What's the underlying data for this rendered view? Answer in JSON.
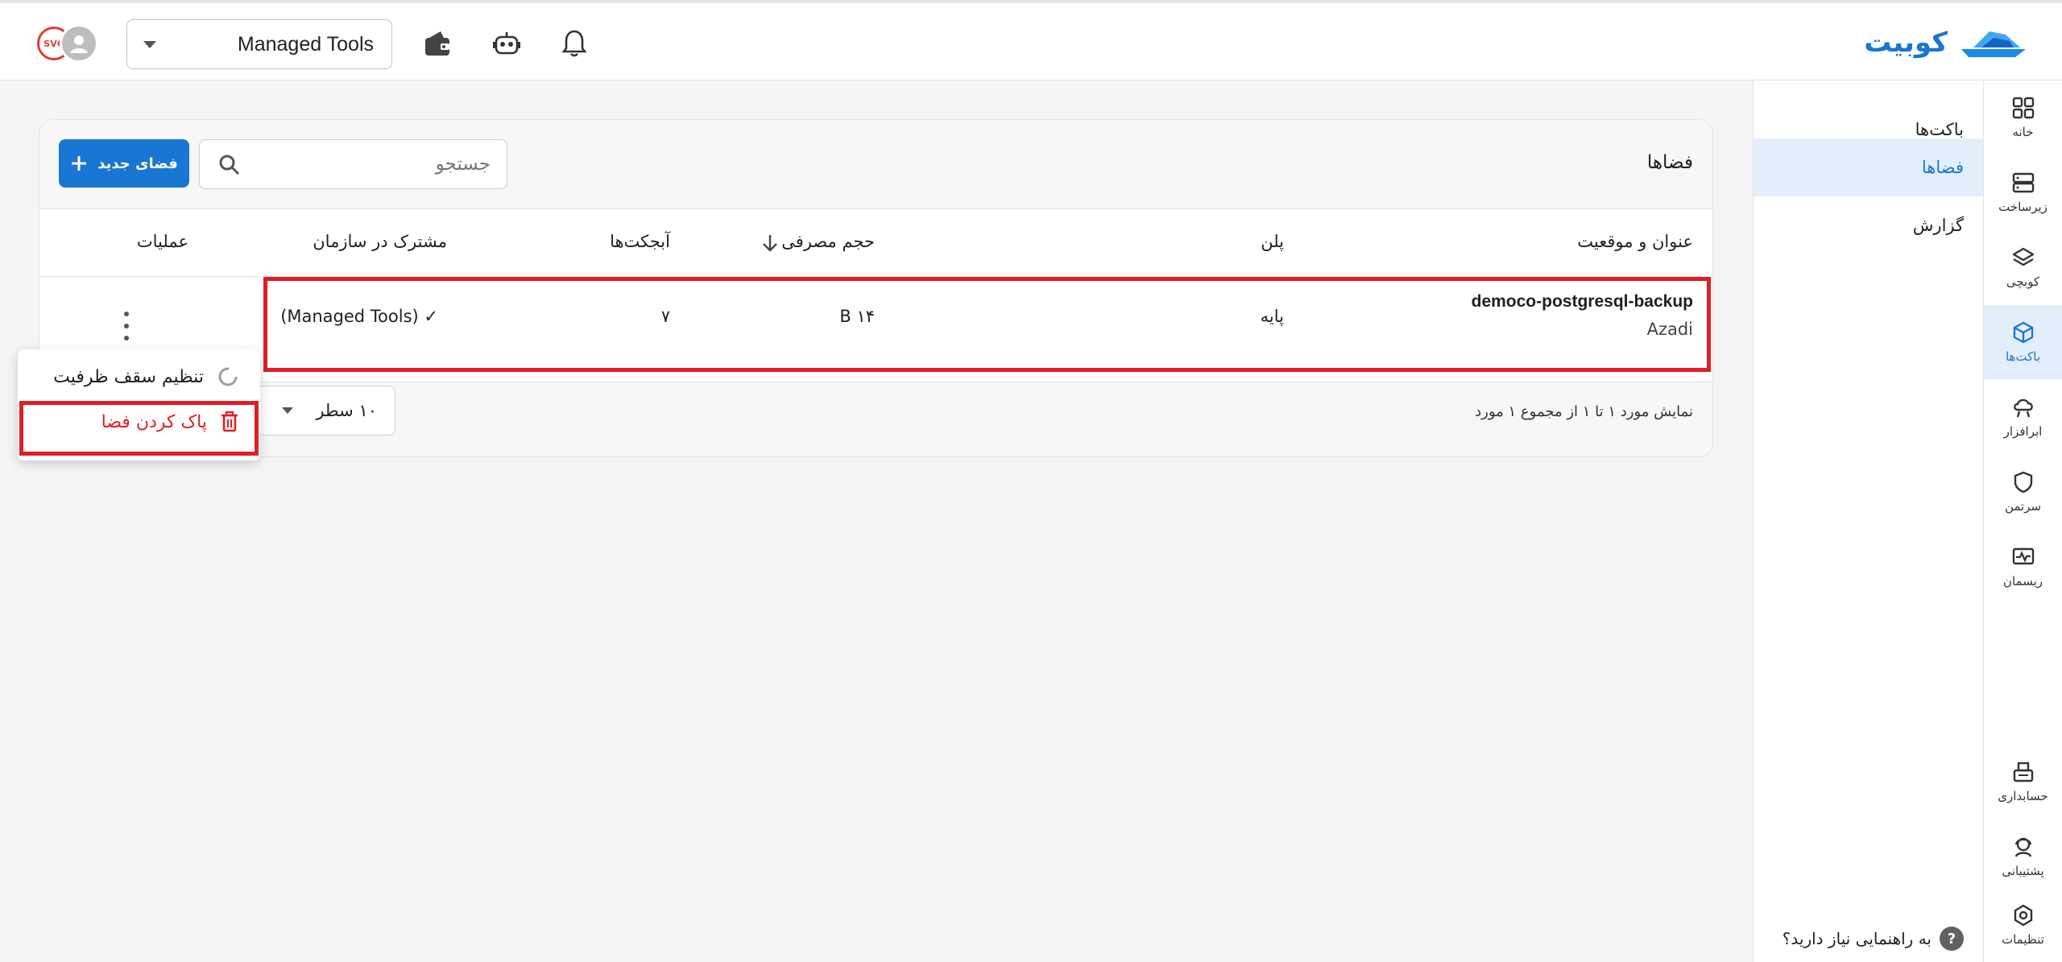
{
  "header": {
    "logo_text": "کوبیت",
    "org_select_value": "Managed Tools",
    "avatar_badge": "SVG",
    "icons": [
      "bell-icon",
      "robot-icon",
      "wallet-icon"
    ]
  },
  "rail": {
    "items": [
      {
        "label": "خانه",
        "icon": "grid-icon"
      },
      {
        "label": "زیرساخت",
        "icon": "server-icon"
      },
      {
        "label": "کوبچی",
        "icon": "layers-icon"
      },
      {
        "label": "باکت‌ها",
        "icon": "cube-icon",
        "active": true
      },
      {
        "label": "ابرافزار",
        "icon": "cloud-icon"
      },
      {
        "label": "سرتمن",
        "icon": "shield-icon"
      },
      {
        "label": "ریسمان",
        "icon": "monitor-pulse-icon"
      },
      {
        "label": "حسابداری",
        "icon": "cash-register-icon"
      },
      {
        "label": "پشتیبانی",
        "icon": "support-agent-icon"
      },
      {
        "label": "تنظیمات",
        "icon": "gear-icon"
      }
    ]
  },
  "subnav": {
    "items": [
      {
        "label": "باکت‌ها"
      },
      {
        "label": "فضاها",
        "active": true
      },
      {
        "label": "گزارش"
      }
    ],
    "help_text": "به راهنمایی نیاز دارید؟",
    "help_icon": "?"
  },
  "main": {
    "title": "فضاها",
    "search_placeholder": "جستجو",
    "new_button": "فضای جدید",
    "columns": {
      "title_location": "عنوان و موقعیت",
      "plan": "پلن",
      "usage": "حجم مصرفی",
      "objects": "آبجکت‌ها",
      "shared": "مشترک در سازمان",
      "actions": "عملیات"
    },
    "row": {
      "name": "democo-postgresql-backup",
      "location": "Azadi",
      "plan": "پایه",
      "usage": "۱۴ B",
      "objects": "۷",
      "shared": "(Managed Tools) ✓"
    },
    "footer_text": "نمایش مورد ۱ تا ۱ از مجموع ۱ مورد",
    "rows_per_page": "۱۰ سطر"
  },
  "menu": {
    "items": [
      {
        "label": "تنظیم سقف ظرفیت",
        "icon": "spinner-icon"
      },
      {
        "label": "پاک کردن فضا",
        "icon": "trash-icon"
      }
    ]
  },
  "colors": {
    "primary": "#1976d2",
    "highlight": "#e01e25",
    "active_bg": "#e3eefb"
  }
}
